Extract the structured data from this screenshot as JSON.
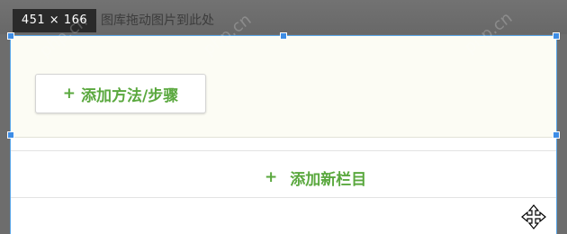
{
  "tooltip": {
    "dimensions": "451 × 166"
  },
  "underlying": {
    "hint_text": "图库拖动图片到此处"
  },
  "method_area": {
    "add_method_label": "添加方法/步骤"
  },
  "section_area": {
    "add_section_label": "添加新栏目"
  },
  "icons": {
    "plus": "+",
    "cursor": "move-cursor-icon"
  },
  "watermark": {
    "text": "php.cn"
  },
  "colors": {
    "accent_green": "#5aa83e",
    "handle_blue": "#3d8de6",
    "panel_bg": "#fcfcf4",
    "backdrop": "#6d6d6d"
  }
}
